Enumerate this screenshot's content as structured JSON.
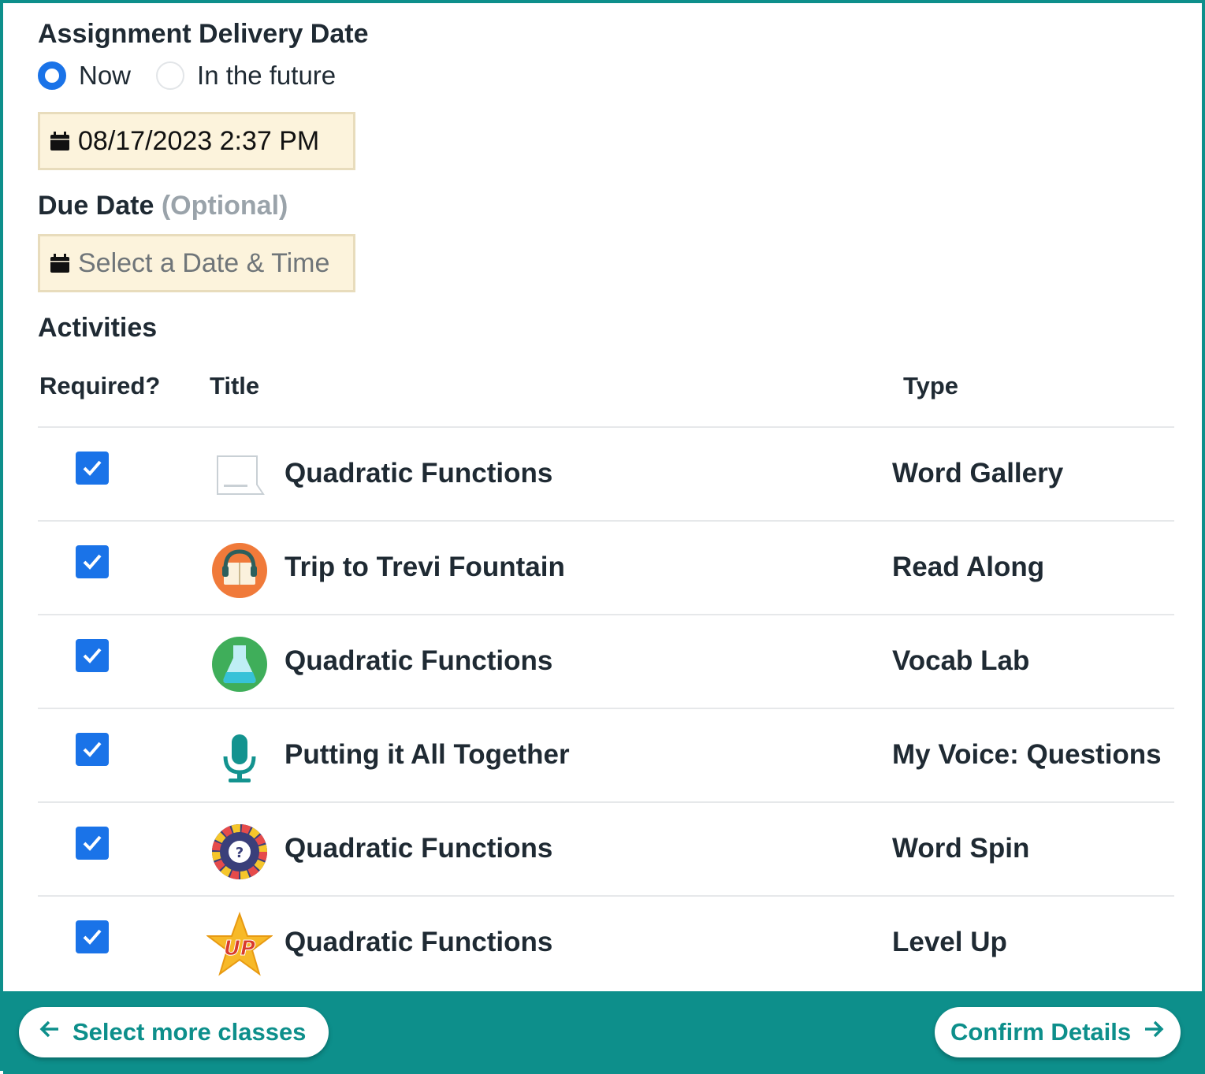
{
  "delivery": {
    "heading": "Assignment Delivery Date",
    "options": [
      {
        "label": "Now",
        "selected": true
      },
      {
        "label": "In the future",
        "selected": false
      }
    ],
    "date_value": "08/17/2023 2:37 PM"
  },
  "due": {
    "heading": "Due Date",
    "optional_label": "(Optional)",
    "placeholder": "Select a Date & Time"
  },
  "activities": {
    "heading": "Activities",
    "columns": {
      "required": "Required?",
      "title": "Title",
      "type": "Type"
    },
    "rows": [
      {
        "required": true,
        "title": "Quadratic Functions",
        "type": "Word Gallery",
        "icon": "word-gallery-icon"
      },
      {
        "required": true,
        "title": "Trip to Trevi Fountain",
        "type": "Read Along",
        "icon": "read-along-icon"
      },
      {
        "required": true,
        "title": "Quadratic Functions",
        "type": "Vocab Lab",
        "icon": "vocab-lab-flask-icon"
      },
      {
        "required": true,
        "title": "Putting it All Together",
        "type": "My Voice: Questions",
        "icon": "microphone-icon"
      },
      {
        "required": true,
        "title": "Quadratic Functions",
        "type": "Word Spin",
        "icon": "word-spin-wheel-icon"
      },
      {
        "required": true,
        "title": "Quadratic Functions",
        "type": "Level Up",
        "icon": "level-up-star-icon"
      }
    ]
  },
  "footer": {
    "back_label": "Select more classes",
    "next_label": "Confirm Details"
  },
  "colors": {
    "accent": "#0d8f8b",
    "checkbox": "#1a73e8",
    "date_field_bg": "#fcf3dc"
  }
}
